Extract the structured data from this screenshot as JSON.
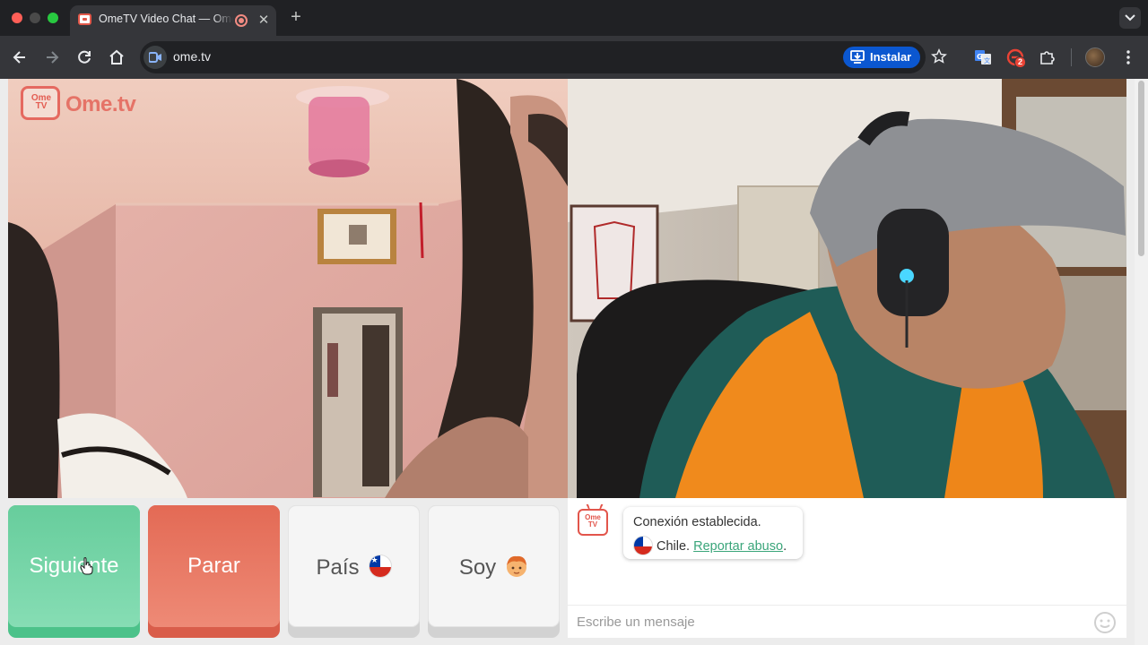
{
  "browser": {
    "tab": {
      "title": "OmeTV Video Chat — Omegle alternative"
    },
    "address": {
      "url": "ome.tv"
    },
    "install_label": "Instalar",
    "extension_badge": "2"
  },
  "page": {
    "logo": {
      "icon_text": "Ome TV",
      "wordmark": "Ome.tv"
    },
    "buttons": {
      "next_label": "Siguiente",
      "stop_label": "Parar",
      "country_label": "País",
      "gender_label": "Soy"
    },
    "chat": {
      "system_logo_text": "Ome TV",
      "status_text": "Conexión establecida.",
      "country_text": "Chile.",
      "report_link": "Reportar abuso",
      "report_suffix": ".",
      "input_placeholder": "Escribe un mensaje"
    }
  },
  "colors": {
    "next": "#67cd9c",
    "stop": "#e36a55",
    "link": "#3aa57a",
    "brand": "#e2554b"
  },
  "icons": {
    "country_flag": "chile-flag-icon",
    "gender": "boy-face-icon",
    "emoji": "smiley-icon"
  }
}
